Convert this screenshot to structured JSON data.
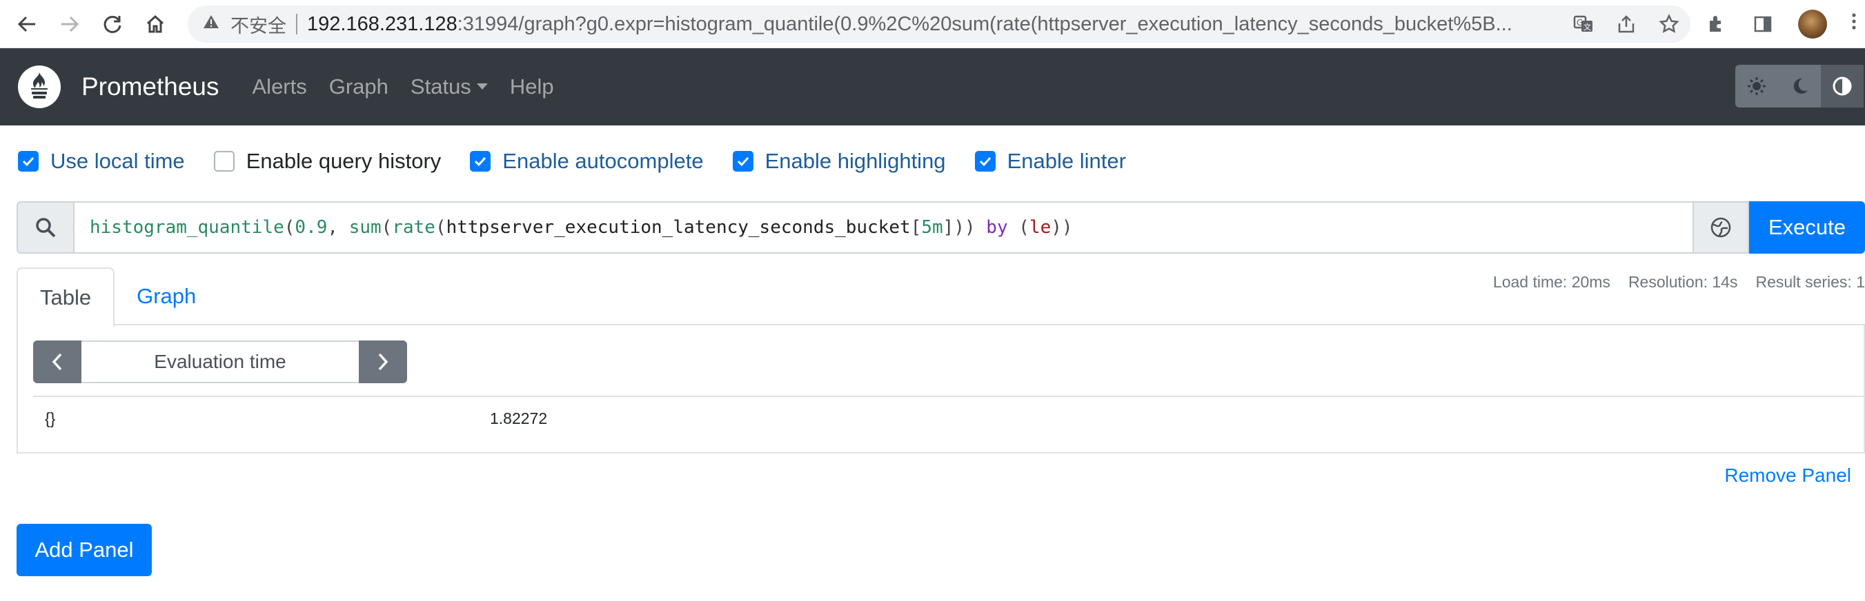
{
  "browser": {
    "insecure_label": "不安全",
    "url_host": "192.168.231.128",
    "url_rest": ":31994/graph?g0.expr=histogram_quantile(0.9%2C%20sum(rate(httpserver_execution_latency_seconds_bucket%5B..."
  },
  "navbar": {
    "brand": "Prometheus",
    "links": [
      "Alerts",
      "Graph",
      "Status",
      "Help"
    ]
  },
  "options": [
    {
      "label": "Use local time",
      "checked": true
    },
    {
      "label": "Enable query history",
      "checked": false
    },
    {
      "label": "Enable autocomplete",
      "checked": true
    },
    {
      "label": "Enable highlighting",
      "checked": true
    },
    {
      "label": "Enable linter",
      "checked": true
    }
  ],
  "expression": {
    "fn1": "histogram_quantile",
    "num": "0.9",
    "fn2": "sum",
    "fn3": "rate",
    "metric": "httpserver_execution_latency_seconds_bucket",
    "range": "5m",
    "kw": "by",
    "label": "le",
    "execute_label": "Execute"
  },
  "panel": {
    "tabs": [
      "Table",
      "Graph"
    ],
    "stats": {
      "load_time": "Load time: 20ms",
      "resolution": "Resolution: 14s",
      "result_series": "Result series: 1"
    },
    "eval_placeholder": "Evaluation time",
    "result": {
      "labels": "{}",
      "value": "1.82272"
    },
    "remove_label": "Remove Panel"
  },
  "add_panel_label": "Add Panel"
}
